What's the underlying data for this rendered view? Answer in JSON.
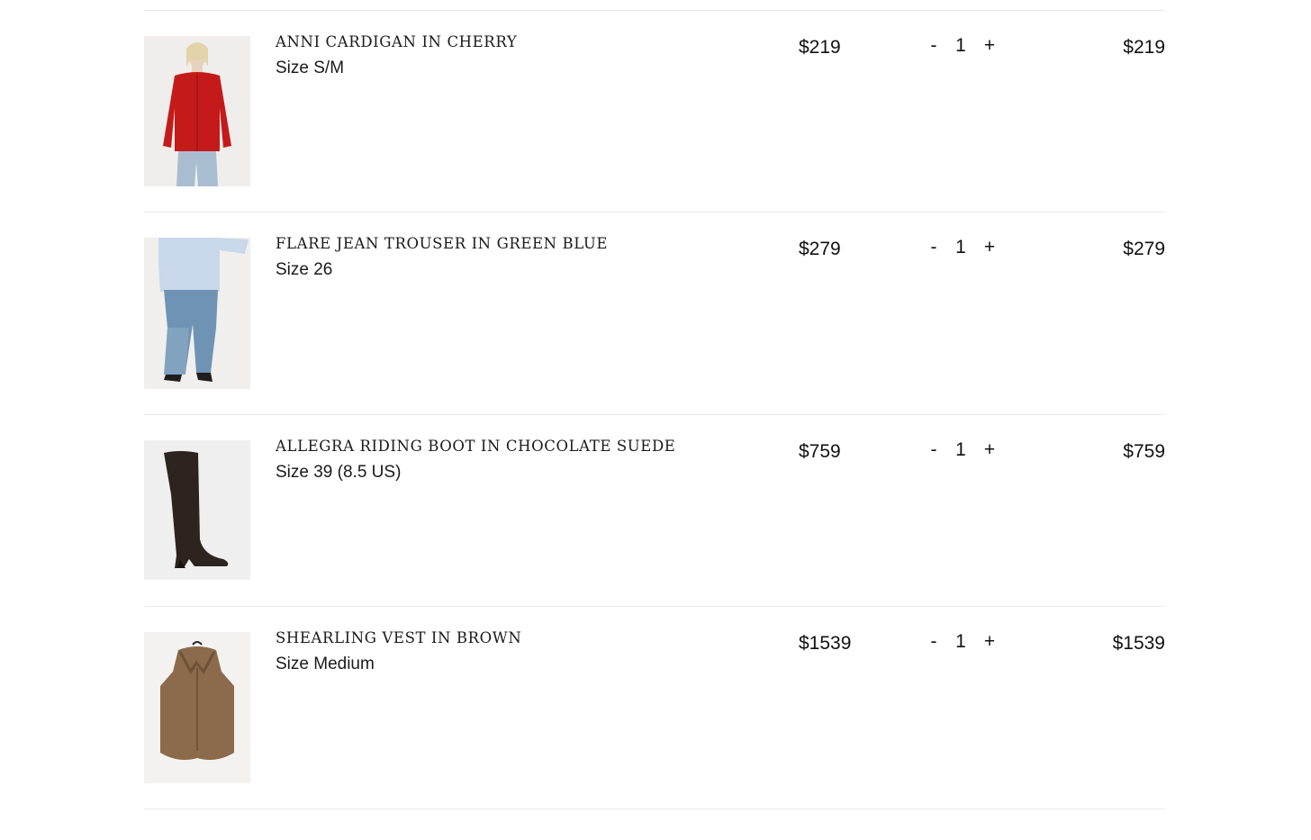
{
  "cart": {
    "items": [
      {
        "name": "ANNI CARDIGAN IN CHERRY",
        "size": "Size S/M",
        "price": "$219",
        "qty_minus": "-",
        "quantity": "1",
        "qty_plus": "+",
        "total": "$219",
        "image_icon": "red-cardigan-photo"
      },
      {
        "name": "FLARE JEAN TROUSER IN GREEN BLUE",
        "size": "Size 26",
        "price": "$279",
        "qty_minus": "-",
        "quantity": "1",
        "qty_plus": "+",
        "total": "$279",
        "image_icon": "flare-jeans-photo"
      },
      {
        "name": "ALLEGRA RIDING BOOT IN CHOCOLATE SUEDE",
        "size": "Size 39 (8.5 US)",
        "price": "$759",
        "qty_minus": "-",
        "quantity": "1",
        "qty_plus": "+",
        "total": "$759",
        "image_icon": "riding-boot-photo"
      },
      {
        "name": "SHEARLING VEST IN BROWN",
        "size": "Size Medium",
        "price": "$1539",
        "qty_minus": "-",
        "quantity": "1",
        "qty_plus": "+",
        "total": "$1539",
        "image_icon": "shearling-vest-photo"
      }
    ]
  },
  "colors": {
    "divider": "#ebebeb",
    "text": "#111111",
    "thumb_bg": "#f1f0ee"
  }
}
